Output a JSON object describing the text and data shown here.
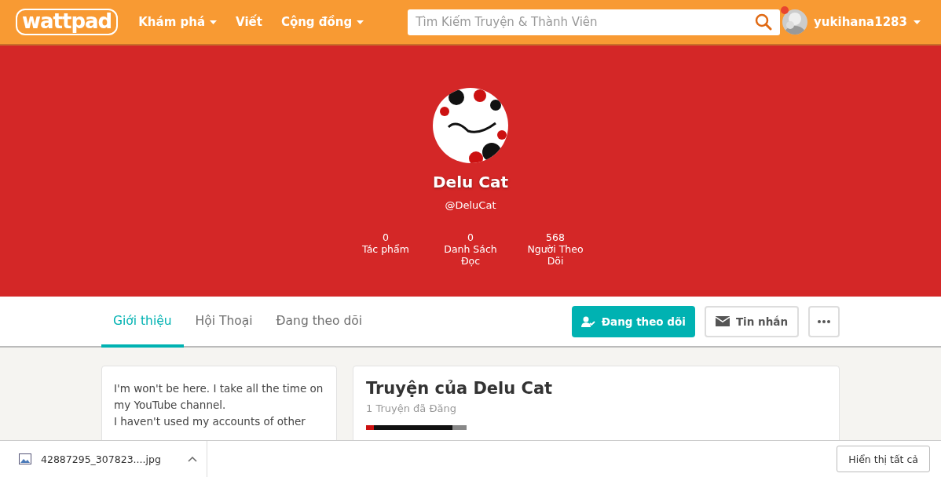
{
  "header": {
    "logo": "wattpad",
    "nav": [
      {
        "label": "Khám phá",
        "dropdown": true
      },
      {
        "label": "Viết",
        "dropdown": false
      },
      {
        "label": "Cộng đồng",
        "dropdown": true
      }
    ],
    "search": {
      "placeholder": "Tìm Kiếm Truyện & Thành Viên"
    },
    "user": {
      "name": "yukihana1283",
      "notification": true
    }
  },
  "profile": {
    "name": "Delu Cat",
    "handle": "@DeluCat",
    "stats": [
      {
        "value": "0",
        "label": "Tác phẩm"
      },
      {
        "value": "0",
        "label": "Danh Sách Đọc"
      },
      {
        "value": "568",
        "label": "Người Theo Dõi"
      }
    ]
  },
  "tabs": [
    {
      "label": "Giới thiệu",
      "selected": true
    },
    {
      "label": "Hội Thoại",
      "selected": false
    },
    {
      "label": "Đang theo dõi",
      "selected": false
    }
  ],
  "actions": {
    "follow": "Đang theo dõi",
    "message": "Tin nhắn"
  },
  "about": {
    "lines": [
      "I'm won't be here. I take all the time on my YouTube channel.",
      "I haven't used my accounts of other"
    ]
  },
  "stories": {
    "title": "Truyện của Delu Cat",
    "count": "1 Truyện đã Đăng"
  },
  "download_bar": {
    "file": "42887295_307823....jpg",
    "show_all": "Hiển thị tất cả"
  }
}
